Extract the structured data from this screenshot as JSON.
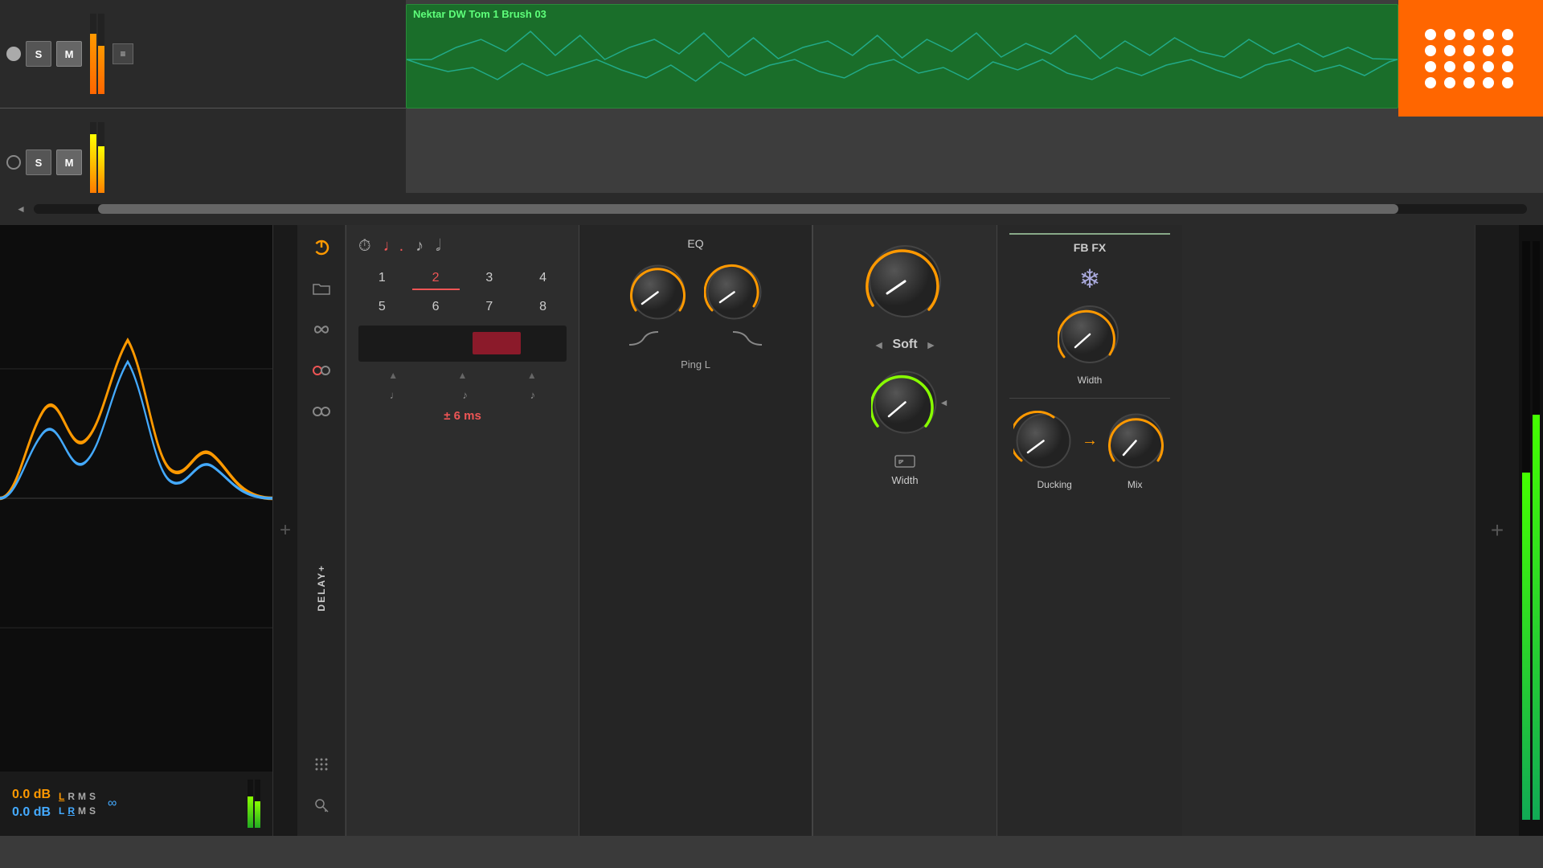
{
  "daw": {
    "track1": {
      "solo": "S",
      "mute": "M",
      "clip_title": "Nektar DW Tom 1 Brush 03"
    },
    "track2": {
      "solo": "S",
      "mute": "M"
    }
  },
  "analyzer": {
    "db_orange": "0.0 dB",
    "db_blue": "0.0 dB",
    "lr_orange_l": "L",
    "lr_orange_r": "R",
    "lr_orange_m": "M",
    "lr_orange_s": "S",
    "lr_blue_l": "L",
    "lr_blue_r": "R",
    "lr_blue_m": "M",
    "lr_blue_s": "S"
  },
  "plugin": {
    "name": "DELAY+",
    "power_color": "#f90",
    "timing": {
      "icons": [
        "clock",
        "note-dotted",
        "note",
        "note-half"
      ],
      "numbers": [
        "1",
        "2",
        "3",
        "4",
        "5",
        "6",
        "7",
        "8"
      ],
      "selected": "2",
      "ms_display": "± 6 ms"
    },
    "eq_title": "EQ",
    "channel_label": "Ping L",
    "soft_label": "Soft",
    "fbfx_title": "FB FX",
    "knobs": {
      "soft_knob_angle": -30,
      "width_angle": -45,
      "ducking_angle": -60,
      "mix_angle": -30,
      "eq_low_angle": -80,
      "eq_high_angle": -70
    },
    "width_label": "Width",
    "ducking_label": "Ducking",
    "mix_label": "Mix"
  },
  "buttons": {
    "add": "+",
    "back_arrow": "◄"
  }
}
